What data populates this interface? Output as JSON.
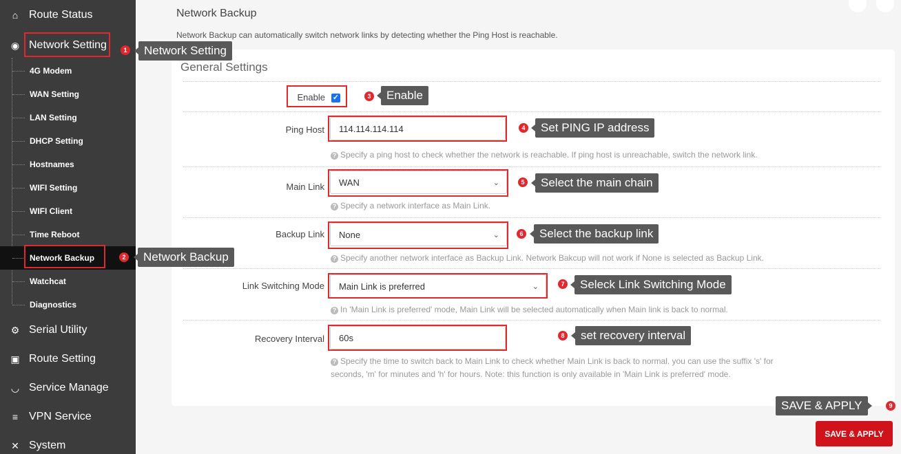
{
  "sidebar": {
    "main_items": [
      {
        "label": "Route Status",
        "icon": "home-icon"
      },
      {
        "label": "Network Setting",
        "icon": "globe-icon"
      },
      {
        "label": "Serial Utility",
        "icon": "cogs-icon"
      },
      {
        "label": "Route Setting",
        "icon": "calendar-icon"
      },
      {
        "label": "Service Manage",
        "icon": "gauge-icon"
      },
      {
        "label": "VPN Service",
        "icon": "list-icon"
      },
      {
        "label": "System",
        "icon": "tools-icon"
      }
    ],
    "sub_items": [
      "4G Modem",
      "WAN Setting",
      "LAN Setting",
      "DHCP Setting",
      "Hostnames",
      "WIFI Setting",
      "WIFI Client",
      "Time Reboot",
      "Network Backup",
      "Watchcat",
      "Diagnostics"
    ],
    "active_sub": "Network Backup"
  },
  "page": {
    "title": "Network Backup",
    "description": "Network Backup can automatically switch network links by detecting whether the Ping Host is reachable.",
    "section_title": "General Settings"
  },
  "form": {
    "enable": {
      "label": "Enable",
      "checked": true
    },
    "ping_host": {
      "label": "Ping Host",
      "value": "114.114.114.114",
      "hint": "Specify a ping host to check whether the network is reachable. If ping host is unreachable, switch the network link."
    },
    "main_link": {
      "label": "Main Link",
      "value": "WAN",
      "hint": "Specify a network interface as Main Link."
    },
    "backup_link": {
      "label": "Backup Link",
      "value": "None",
      "hint": "Specify another network interface as Backup Link. Network Bakcup will not work if None is selected as Backup Link."
    },
    "switch_mode": {
      "label": "Link Switching Mode",
      "value": "Main Link is preferred",
      "hint": "In 'Main Link is preferred' mode, Main Link will be selected automatically when Main link is back to normal."
    },
    "recovery": {
      "label": "Recovery Interval",
      "value": "60s",
      "hint_line1": "Specify the time to switch back to Main Link to check whether Main Link is back to normal. you can use the suffix 's' for",
      "hint_line2": "seconds, 'm' for minutes and 'h' for hours. Note: this function is only available in 'Main Link is preferred' mode."
    },
    "save_label": "SAVE & APPLY"
  },
  "annotations": [
    {
      "num": "1",
      "text": "Network Setting"
    },
    {
      "num": "2",
      "text": "Network Backup"
    },
    {
      "num": "3",
      "text": "Enable"
    },
    {
      "num": "4",
      "text": "Set PING IP address"
    },
    {
      "num": "5",
      "text": "Select the main chain"
    },
    {
      "num": "6",
      "text": "Select the backup link"
    },
    {
      "num": "7",
      "text": "Seleck Link Switching Mode"
    },
    {
      "num": "8",
      "text": "set recovery interval"
    },
    {
      "num": "9",
      "text": "SAVE & APPLY"
    }
  ],
  "colors": {
    "accent": "#d0131b",
    "sidebar": "#3c3c3c",
    "annotation": "#e0282e",
    "callout": "#595959"
  }
}
